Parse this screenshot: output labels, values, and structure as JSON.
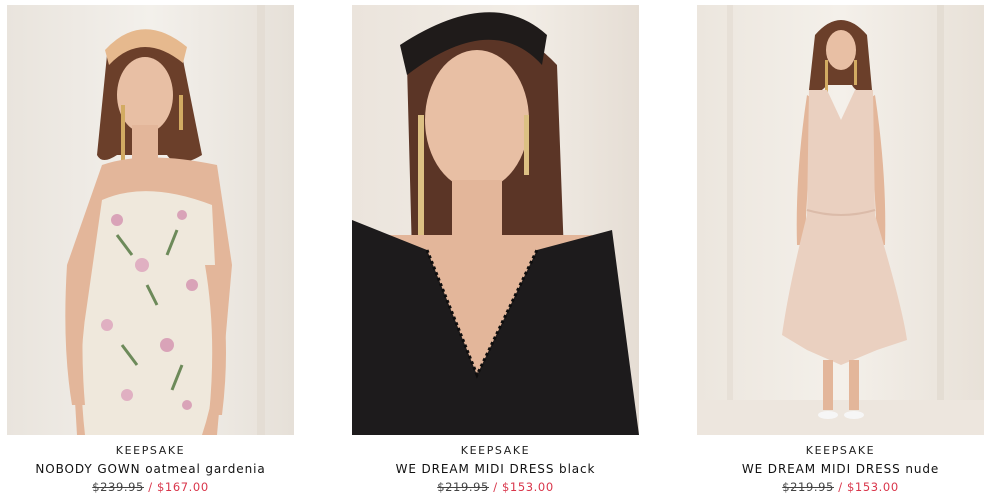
{
  "products": [
    {
      "brand": "KEEPSAKE",
      "name": "NOBODY GOWN oatmeal gardenia",
      "old_price": "$239.95",
      "separator": "/",
      "sale_price": "$167.00",
      "image": "model-floral-gown-photo"
    },
    {
      "brand": "KEEPSAKE",
      "name": "WE DREAM MIDI DRESS black",
      "old_price": "$219.95",
      "separator": "/",
      "sale_price": "$153.00",
      "image": "model-black-dress-photo"
    },
    {
      "brand": "KEEPSAKE",
      "name": "WE DREAM MIDI DRESS nude",
      "old_price": "$219.95",
      "separator": "/",
      "sale_price": "$153.00",
      "image": "model-nude-dress-photo"
    }
  ],
  "colors": {
    "sale_red": "#d9364b",
    "text": "#111111",
    "backdrop": "#efe9e2"
  }
}
